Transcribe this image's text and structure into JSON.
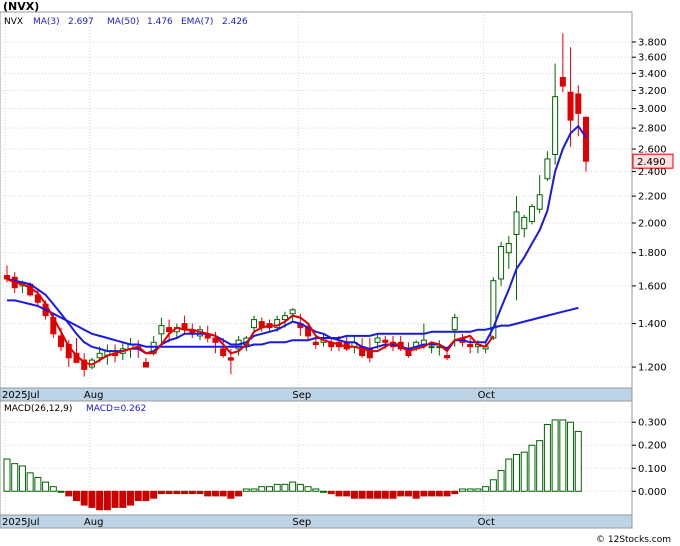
{
  "title": "(NVX)",
  "legend": {
    "ticker": "NVX",
    "ma3_label": "MA(3)",
    "ma3_value": "2.697",
    "ma50_label": "MA(50)",
    "ma50_value": "1.476",
    "ema7_label": "EMA(7)",
    "ema7_value": "2.426"
  },
  "macd_legend": {
    "label": "MACD(26,12,9)",
    "value_label": "MACD=0.262"
  },
  "last_price_label": "2.490",
  "watermark": "© 12Stocks.com",
  "x_axis_labels": [
    "2025Jul",
    "Aug",
    "Sep",
    "Oct"
  ],
  "colors": {
    "up": "#006400",
    "down": "#e00000",
    "ma3": "#e00000",
    "ma_blue": "#1a1adc",
    "axis_band": "#bcd4e6",
    "grid": "#d3d3d3",
    "price_box": "#ffe0e0",
    "macd_pos": "#006400",
    "macd_neg": "#cc0000"
  },
  "chart_data": [
    {
      "type": "candlestick",
      "title": "(NVX)",
      "price_scale": "log",
      "y_ticks": [
        "3.800",
        "3.600",
        "3.400",
        "3.200",
        "3.000",
        "2.800",
        "2.600",
        "2.400",
        "2.200",
        "2.000",
        "1.800",
        "1.600",
        "1.400",
        "1.200"
      ],
      "y_tick_values": [
        3.8,
        3.6,
        3.4,
        3.2,
        3.0,
        2.8,
        2.6,
        2.4,
        2.2,
        2.0,
        1.8,
        1.6,
        1.4,
        1.2
      ],
      "ylim": [
        1.13,
        4.05
      ],
      "x_labels": [
        [
          "2025Jul",
          0
        ],
        [
          "Aug",
          11
        ],
        [
          "Sep",
          38
        ],
        [
          "Oct",
          62
        ]
      ],
      "num_bars": 75,
      "last_price": 2.49,
      "candles": [
        [
          1.66,
          1.72,
          1.62,
          1.64
        ],
        [
          1.65,
          1.68,
          1.56,
          1.59
        ],
        [
          1.6,
          1.63,
          1.56,
          1.62
        ],
        [
          1.61,
          1.62,
          1.54,
          1.55
        ],
        [
          1.55,
          1.58,
          1.49,
          1.51
        ],
        [
          1.5,
          1.52,
          1.42,
          1.44
        ],
        [
          1.43,
          1.45,
          1.33,
          1.35
        ],
        [
          1.34,
          1.38,
          1.27,
          1.29
        ],
        [
          1.3,
          1.32,
          1.2,
          1.24
        ],
        [
          1.26,
          1.33,
          1.22,
          1.22
        ],
        [
          1.23,
          1.26,
          1.16,
          1.19
        ],
        [
          1.2,
          1.24,
          1.19,
          1.23
        ],
        [
          1.24,
          1.29,
          1.22,
          1.26
        ],
        [
          1.25,
          1.3,
          1.21,
          1.27
        ],
        [
          1.26,
          1.3,
          1.22,
          1.25
        ],
        [
          1.26,
          1.31,
          1.23,
          1.28
        ],
        [
          1.28,
          1.33,
          1.24,
          1.3
        ],
        [
          1.29,
          1.32,
          1.24,
          1.28
        ],
        [
          1.22,
          1.24,
          1.2,
          1.2
        ],
        [
          1.26,
          1.34,
          1.25,
          1.31
        ],
        [
          1.35,
          1.43,
          1.3,
          1.39
        ],
        [
          1.38,
          1.42,
          1.31,
          1.36
        ],
        [
          1.36,
          1.4,
          1.33,
          1.38
        ],
        [
          1.4,
          1.44,
          1.35,
          1.37
        ],
        [
          1.37,
          1.4,
          1.33,
          1.35
        ],
        [
          1.34,
          1.39,
          1.32,
          1.37
        ],
        [
          1.35,
          1.39,
          1.31,
          1.33
        ],
        [
          1.33,
          1.36,
          1.26,
          1.31
        ],
        [
          1.28,
          1.33,
          1.24,
          1.25
        ],
        [
          1.24,
          1.28,
          1.17,
          1.23
        ],
        [
          1.28,
          1.34,
          1.25,
          1.32
        ],
        [
          1.3,
          1.34,
          1.27,
          1.33
        ],
        [
          1.38,
          1.44,
          1.36,
          1.42
        ],
        [
          1.41,
          1.43,
          1.36,
          1.38
        ],
        [
          1.4,
          1.42,
          1.36,
          1.38
        ],
        [
          1.38,
          1.44,
          1.36,
          1.42
        ],
        [
          1.42,
          1.46,
          1.38,
          1.44
        ],
        [
          1.45,
          1.48,
          1.41,
          1.47
        ],
        [
          1.4,
          1.45,
          1.34,
          1.38
        ],
        [
          1.38,
          1.4,
          1.32,
          1.34
        ],
        [
          1.31,
          1.34,
          1.28,
          1.3
        ],
        [
          1.31,
          1.35,
          1.29,
          1.33
        ],
        [
          1.31,
          1.33,
          1.27,
          1.29
        ],
        [
          1.31,
          1.34,
          1.27,
          1.29
        ],
        [
          1.31,
          1.34,
          1.27,
          1.28
        ],
        [
          1.29,
          1.34,
          1.26,
          1.31
        ],
        [
          1.29,
          1.33,
          1.24,
          1.25
        ],
        [
          1.28,
          1.33,
          1.22,
          1.24
        ],
        [
          1.31,
          1.35,
          1.28,
          1.33
        ],
        [
          1.32,
          1.34,
          1.28,
          1.31
        ],
        [
          1.31,
          1.34,
          1.27,
          1.29
        ],
        [
          1.31,
          1.34,
          1.27,
          1.28
        ],
        [
          1.28,
          1.31,
          1.24,
          1.25
        ],
        [
          1.29,
          1.32,
          1.27,
          1.31
        ],
        [
          1.3,
          1.4,
          1.28,
          1.32
        ],
        [
          1.29,
          1.31,
          1.26,
          1.29
        ],
        [
          1.29,
          1.32,
          1.25,
          1.29
        ],
        [
          1.25,
          1.29,
          1.23,
          1.24
        ],
        [
          1.37,
          1.45,
          1.29,
          1.43
        ],
        [
          1.33,
          1.35,
          1.29,
          1.31
        ],
        [
          1.3,
          1.33,
          1.26,
          1.29
        ],
        [
          1.29,
          1.32,
          1.26,
          1.3
        ],
        [
          1.28,
          1.32,
          1.26,
          1.29
        ],
        [
          1.33,
          1.65,
          1.32,
          1.63
        ],
        [
          1.64,
          1.87,
          1.6,
          1.84
        ],
        [
          1.8,
          1.91,
          1.7,
          1.86
        ],
        [
          1.92,
          2.2,
          1.52,
          2.08
        ],
        [
          1.96,
          2.06,
          1.9,
          2.04
        ],
        [
          2.01,
          2.14,
          1.99,
          2.12
        ],
        [
          2.1,
          2.37,
          2.07,
          2.21
        ],
        [
          2.34,
          2.58,
          2.32,
          2.51
        ],
        [
          2.55,
          3.52,
          2.46,
          3.13
        ],
        [
          3.35,
          3.92,
          3.18,
          3.25
        ],
        [
          3.18,
          3.73,
          2.62,
          2.88
        ],
        [
          3.16,
          3.26,
          2.72,
          2.95
        ],
        [
          2.91,
          2.91,
          2.4,
          2.49
        ]
      ],
      "ma3": [
        1.64,
        1.62,
        1.61,
        1.59,
        1.56,
        1.5,
        1.43,
        1.36,
        1.29,
        1.25,
        1.22,
        1.21,
        1.23,
        1.25,
        1.26,
        1.27,
        1.28,
        1.29,
        1.26,
        1.26,
        1.3,
        1.35,
        1.38,
        1.37,
        1.37,
        1.36,
        1.35,
        1.34,
        1.3,
        1.26,
        1.27,
        1.3,
        1.36,
        1.38,
        1.39,
        1.39,
        1.41,
        1.44,
        1.43,
        1.4,
        1.34,
        1.32,
        1.31,
        1.3,
        1.29,
        1.29,
        1.28,
        1.27,
        1.27,
        1.29,
        1.31,
        1.29,
        1.27,
        1.28,
        1.29,
        1.31,
        1.3,
        1.27,
        1.32,
        1.33,
        1.34,
        1.3,
        1.29,
        1.34
      ],
      "ema7": [
        1.64,
        1.63,
        1.62,
        1.61,
        1.58,
        1.55,
        1.5,
        1.45,
        1.4,
        1.35,
        1.31,
        1.29,
        1.28,
        1.27,
        1.27,
        1.27,
        1.28,
        1.28,
        1.26,
        1.27,
        1.3,
        1.32,
        1.33,
        1.35,
        1.35,
        1.35,
        1.35,
        1.34,
        1.32,
        1.3,
        1.3,
        1.31,
        1.34,
        1.35,
        1.36,
        1.37,
        1.39,
        1.41,
        1.4,
        1.38,
        1.36,
        1.35,
        1.33,
        1.32,
        1.31,
        1.31,
        1.29,
        1.28,
        1.29,
        1.3,
        1.3,
        1.29,
        1.28,
        1.29,
        1.3,
        1.3,
        1.3,
        1.28,
        1.32,
        1.32,
        1.31,
        1.31,
        1.31,
        1.38,
        1.48,
        1.58,
        1.7,
        1.77,
        1.86,
        1.95,
        2.09,
        2.4,
        2.6,
        2.75,
        2.82,
        2.71
      ],
      "ma50_start": 0,
      "ma50": [
        1.52,
        1.52,
        1.51,
        1.5,
        1.49,
        1.47,
        1.45,
        1.43,
        1.41,
        1.39,
        1.37,
        1.35,
        1.34,
        1.33,
        1.32,
        1.31,
        1.3,
        1.3,
        1.29,
        1.29,
        1.29,
        1.29,
        1.29,
        1.29,
        1.29,
        1.29,
        1.29,
        1.29,
        1.29,
        1.29,
        1.29,
        1.29,
        1.3,
        1.3,
        1.31,
        1.31,
        1.31,
        1.32,
        1.32,
        1.32,
        1.33,
        1.33,
        1.33,
        1.33,
        1.34,
        1.34,
        1.34,
        1.34,
        1.35,
        1.35,
        1.35,
        1.35,
        1.35,
        1.35,
        1.35,
        1.36,
        1.36,
        1.36,
        1.36,
        1.36,
        1.36,
        1.37,
        1.37,
        1.38,
        1.39,
        1.39,
        1.4,
        1.41,
        1.42,
        1.43,
        1.44,
        1.45,
        1.46,
        1.47,
        1.48
      ]
    },
    {
      "type": "bar",
      "title": "MACD(26,12,9)",
      "y_ticks": [
        "0.300",
        "0.200",
        "0.100",
        "0.000"
      ],
      "y_tick_values": [
        0.3,
        0.2,
        0.1,
        0.0
      ],
      "ylim": [
        -0.09,
        0.34
      ],
      "values": [
        0.14,
        0.12,
        0.11,
        0.08,
        0.06,
        0.04,
        0.02,
        0.0,
        -0.02,
        -0.04,
        -0.06,
        -0.07,
        -0.08,
        -0.08,
        -0.07,
        -0.07,
        -0.06,
        -0.04,
        -0.04,
        -0.03,
        -0.01,
        -0.01,
        -0.01,
        -0.01,
        -0.01,
        -0.01,
        -0.02,
        -0.02,
        -0.02,
        -0.03,
        -0.02,
        0.01,
        0.01,
        0.02,
        0.02,
        0.03,
        0.03,
        0.04,
        0.03,
        0.02,
        0.01,
        0.0,
        -0.01,
        -0.02,
        -0.02,
        -0.03,
        -0.03,
        -0.03,
        -0.03,
        -0.03,
        -0.03,
        -0.02,
        -0.02,
        -0.03,
        -0.02,
        -0.02,
        -0.02,
        -0.02,
        -0.01,
        0.01,
        0.01,
        0.01,
        0.02,
        0.05,
        0.09,
        0.14,
        0.16,
        0.17,
        0.2,
        0.22,
        0.29,
        0.31,
        0.31,
        0.3,
        0.26
      ]
    }
  ]
}
